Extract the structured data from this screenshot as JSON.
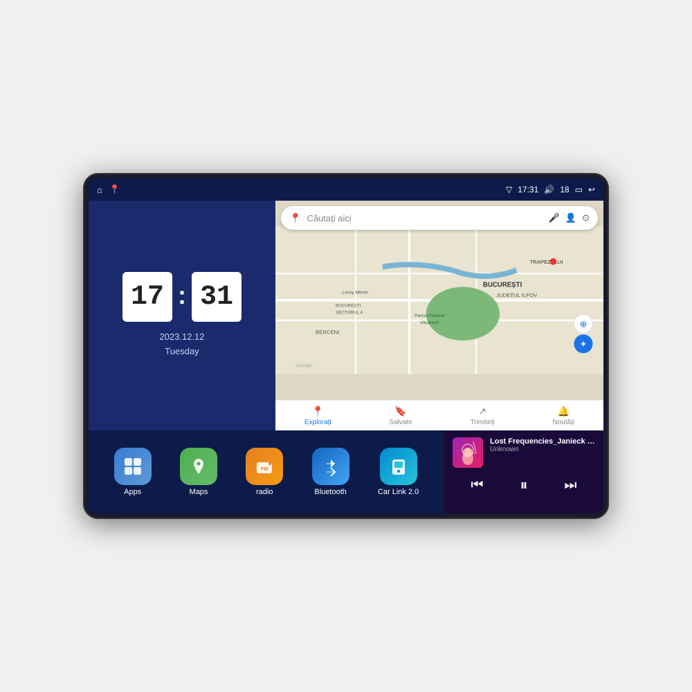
{
  "device": {
    "status_bar": {
      "time": "17:31",
      "signal_icon": "▽",
      "volume_icon": "🔊",
      "battery_level": "18",
      "battery_icon": "🔋",
      "back_icon": "↩",
      "home_icon": "⌂",
      "maps_icon": "📍"
    },
    "clock": {
      "hours": "17",
      "minutes": "31",
      "date": "2023.12.12",
      "day": "Tuesday"
    },
    "map": {
      "search_placeholder": "Căutați aici",
      "nav_items": [
        {
          "label": "Explorați",
          "icon": "📍",
          "active": true
        },
        {
          "label": "Salvate",
          "icon": "🔖",
          "active": false
        },
        {
          "label": "Trimiteți",
          "icon": "↗",
          "active": false
        },
        {
          "label": "Noutăți",
          "icon": "🔔",
          "active": false
        }
      ],
      "map_labels": [
        "BUCUREȘTI",
        "JUDEȚUL ILFOV",
        "TRAPEZULUI",
        "BERCENI",
        "Parcul Natural Văcărești",
        "Leroy Merlin",
        "BUCUREȘTI SECTORUL 4",
        "Google"
      ]
    },
    "apps": [
      {
        "id": "apps",
        "label": "Apps",
        "icon": "⊞",
        "color_class": "app-apps"
      },
      {
        "id": "maps",
        "label": "Maps",
        "icon": "🗺",
        "color_class": "app-maps"
      },
      {
        "id": "radio",
        "label": "radio",
        "icon": "📻",
        "color_class": "app-radio"
      },
      {
        "id": "bluetooth",
        "label": "Bluetooth",
        "icon": "🔷",
        "color_class": "app-bluetooth"
      },
      {
        "id": "carlink",
        "label": "Car Link 2.0",
        "icon": "📱",
        "color_class": "app-carlink"
      }
    ],
    "music": {
      "title": "Lost Frequencies_Janieck Devy-...",
      "artist": "Unknown",
      "prev_icon": "⏮",
      "play_icon": "⏸",
      "next_icon": "⏭"
    }
  }
}
